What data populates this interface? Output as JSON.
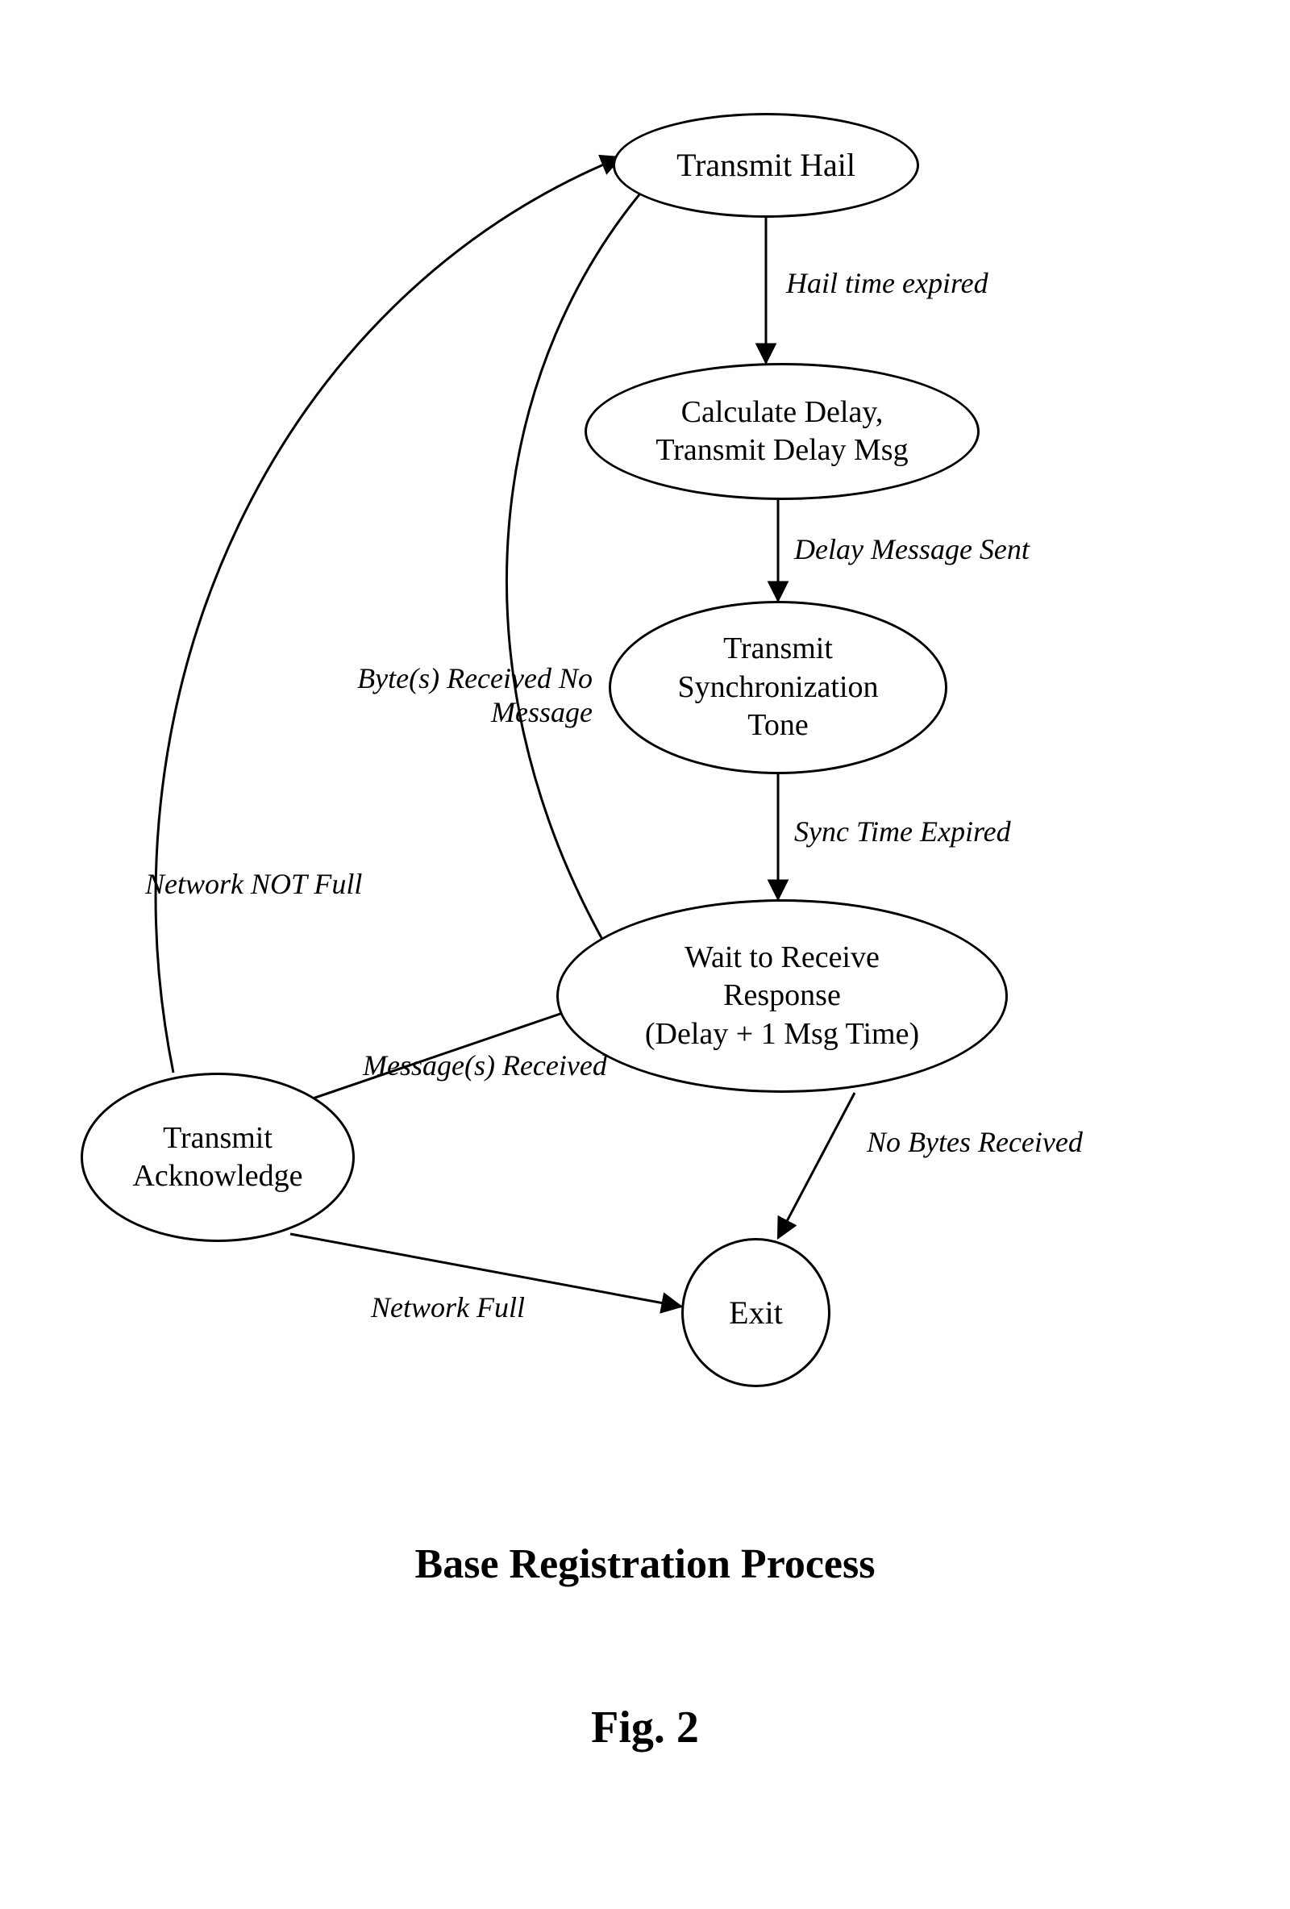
{
  "chart_data": {
    "type": "state-diagram",
    "title": "Base Registration Process",
    "figure_label": "Fig. 2",
    "nodes": [
      {
        "id": "hail",
        "label": "Transmit Hail"
      },
      {
        "id": "delay",
        "label": "Calculate Delay,\nTransmit Delay Msg"
      },
      {
        "id": "sync",
        "label": "Transmit\nSynchronization\nTone"
      },
      {
        "id": "wait",
        "label": "Wait to Receive\nResponse\n(Delay + 1 Msg Time)"
      },
      {
        "id": "ack",
        "label": "Transmit\nAcknowledge"
      },
      {
        "id": "exit",
        "label": "Exit"
      }
    ],
    "edges": [
      {
        "from": "hail",
        "to": "delay",
        "label": "Hail time expired"
      },
      {
        "from": "delay",
        "to": "sync",
        "label": "Delay Message Sent"
      },
      {
        "from": "sync",
        "to": "wait",
        "label": "Sync Time Expired"
      },
      {
        "from": "wait",
        "to": "exit",
        "label": "No Bytes Received"
      },
      {
        "from": "wait",
        "to": "ack",
        "label": "Message(s)\nReceived"
      },
      {
        "from": "wait",
        "to": "hail",
        "label": "Byte(s) Received\nNo Message"
      },
      {
        "from": "ack",
        "to": "hail",
        "label": "Network NOT Full"
      },
      {
        "from": "ack",
        "to": "exit",
        "label": "Network Full"
      }
    ]
  },
  "nodes": {
    "hail": "Transmit Hail",
    "delay_l1": "Calculate Delay,",
    "delay_l2": "Transmit Delay Msg",
    "sync_l1": "Transmit",
    "sync_l2": "Synchronization",
    "sync_l3": "Tone",
    "wait_l1": "Wait to Receive",
    "wait_l2": "Response",
    "wait_l3": "(Delay + 1 Msg Time)",
    "ack_l1": "Transmit",
    "ack_l2": "Acknowledge",
    "exit": "Exit"
  },
  "edges": {
    "hail_delay": "Hail time expired",
    "delay_sync": "Delay Message Sent",
    "sync_wait": "Sync Time Expired",
    "wait_exit": "No Bytes Received",
    "wait_ack_l1": "Message(s)",
    "wait_ack_l2": "Received",
    "wait_hail_l1": "Byte(s) Received",
    "wait_hail_l2": "No Message",
    "ack_hail": "Network NOT Full",
    "ack_exit": "Network Full"
  },
  "title": "Base Registration Process",
  "figure": "Fig. 2"
}
